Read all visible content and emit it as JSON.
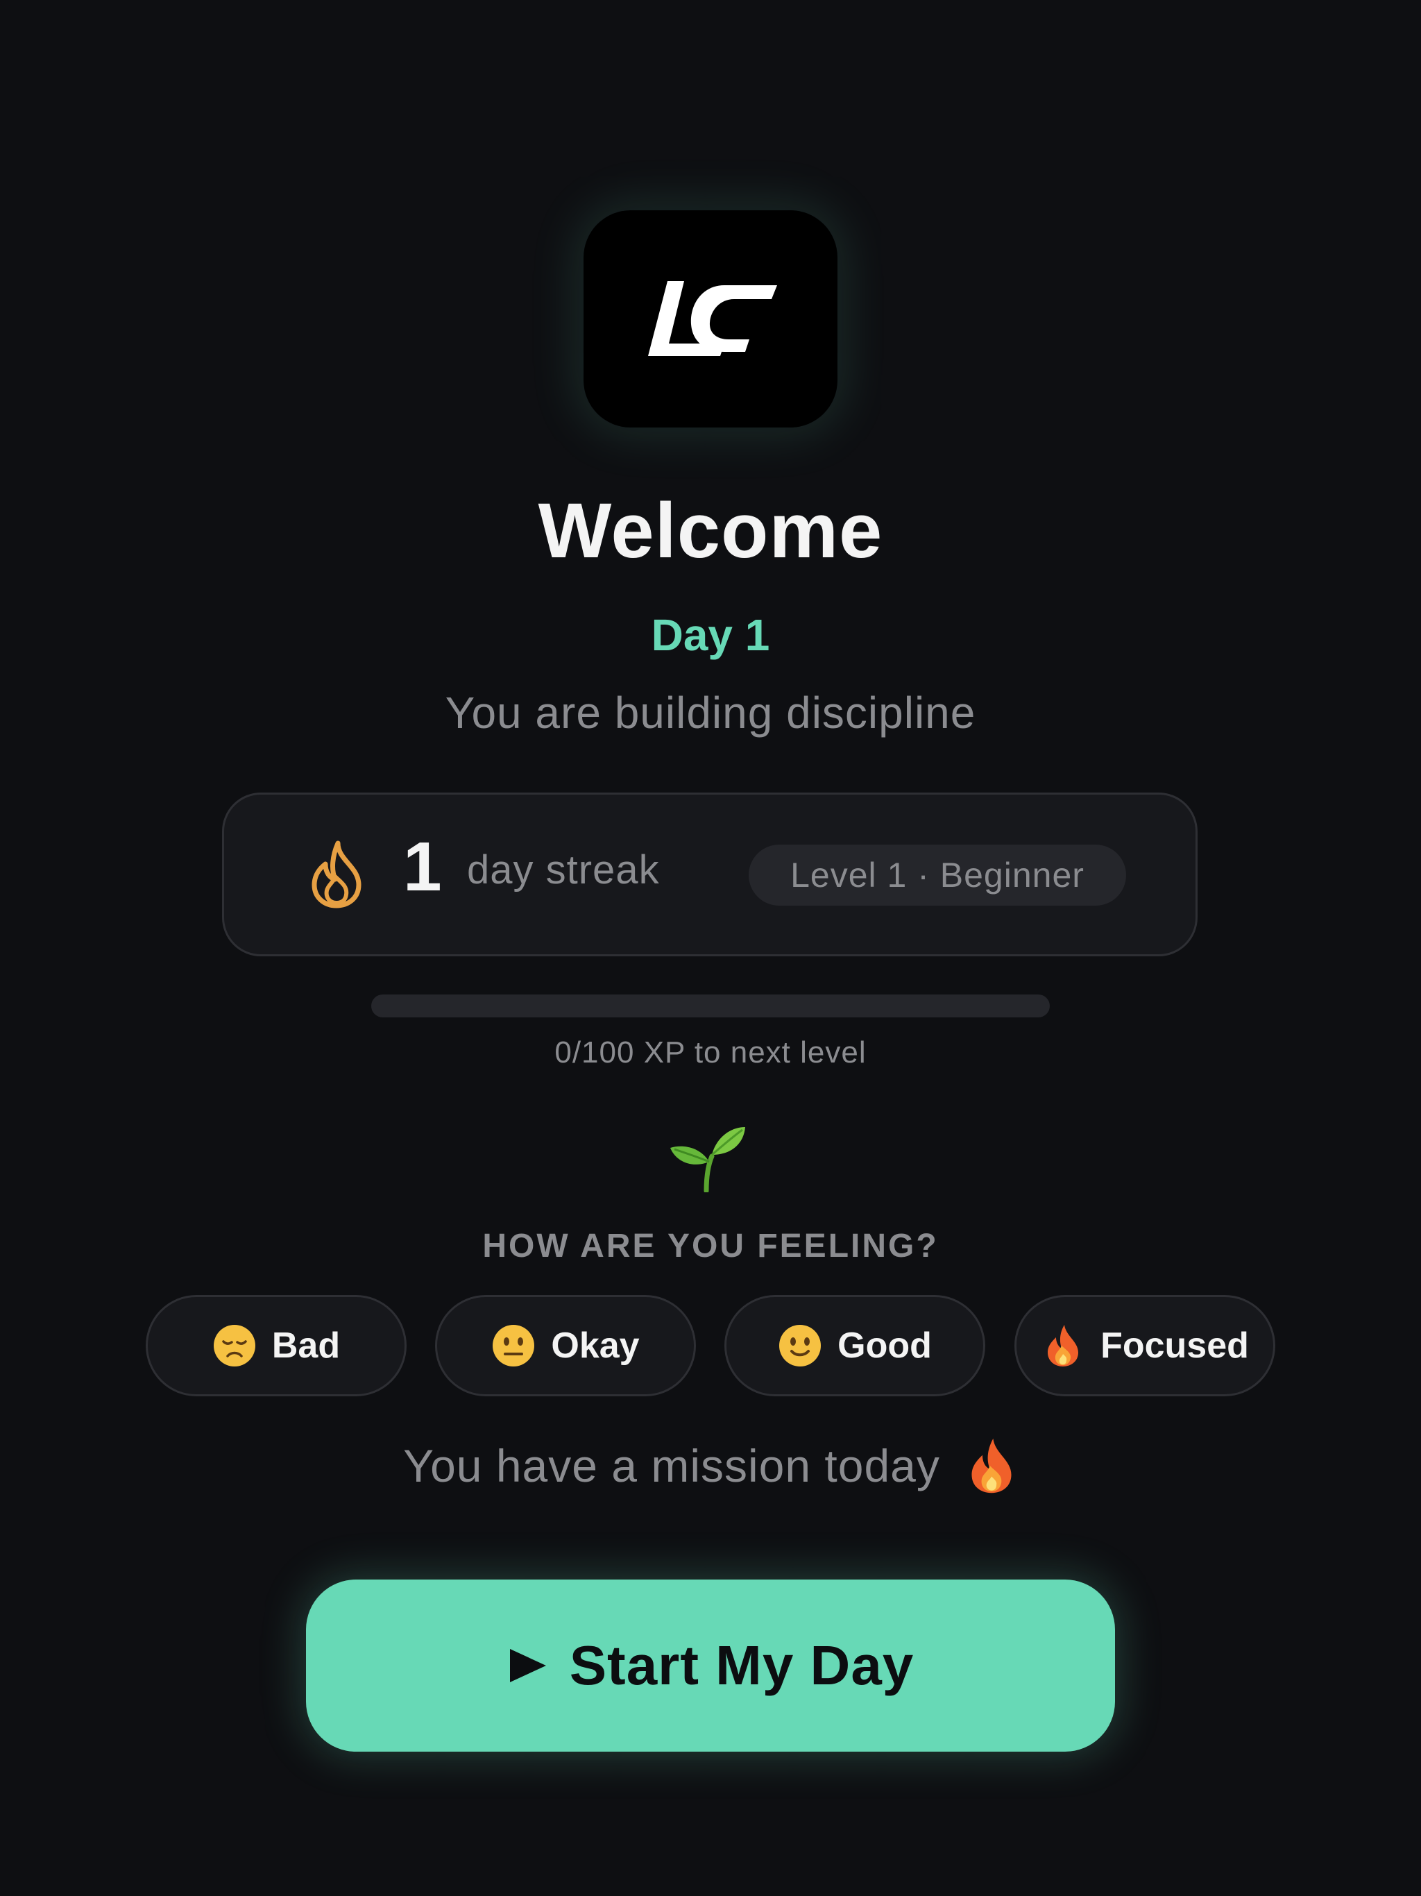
{
  "app": {
    "logo_text": "LC"
  },
  "welcome": {
    "title": "Welcome",
    "day_label": "Day 1",
    "subtitle": "You are building discipline"
  },
  "streak": {
    "count": "1",
    "label": "day streak",
    "level_badge": "Level 1 · Beginner",
    "icon": "flame-icon"
  },
  "xp": {
    "current": 0,
    "max": 100,
    "text": "0/100 XP to next level",
    "progress_fraction": 0
  },
  "milestone_icon": "sprout-icon",
  "feeling": {
    "heading": "HOW ARE YOU FEELING?",
    "options": [
      {
        "label": "Bad",
        "icon": "disappointed-face-icon"
      },
      {
        "label": "Okay",
        "icon": "neutral-face-icon"
      },
      {
        "label": "Good",
        "icon": "slight-smile-icon"
      },
      {
        "label": "Focused",
        "icon": "fire-icon"
      }
    ]
  },
  "mission": {
    "text": "You have a mission today",
    "icon": "fire-icon"
  },
  "start_button": {
    "label": "Start My Day",
    "icon": "play-icon"
  },
  "colors": {
    "background": "#0e0f12",
    "accent": "#67d9b6",
    "card": "#17181c",
    "muted_text": "#8b8c90",
    "flame": "#e7a043"
  }
}
